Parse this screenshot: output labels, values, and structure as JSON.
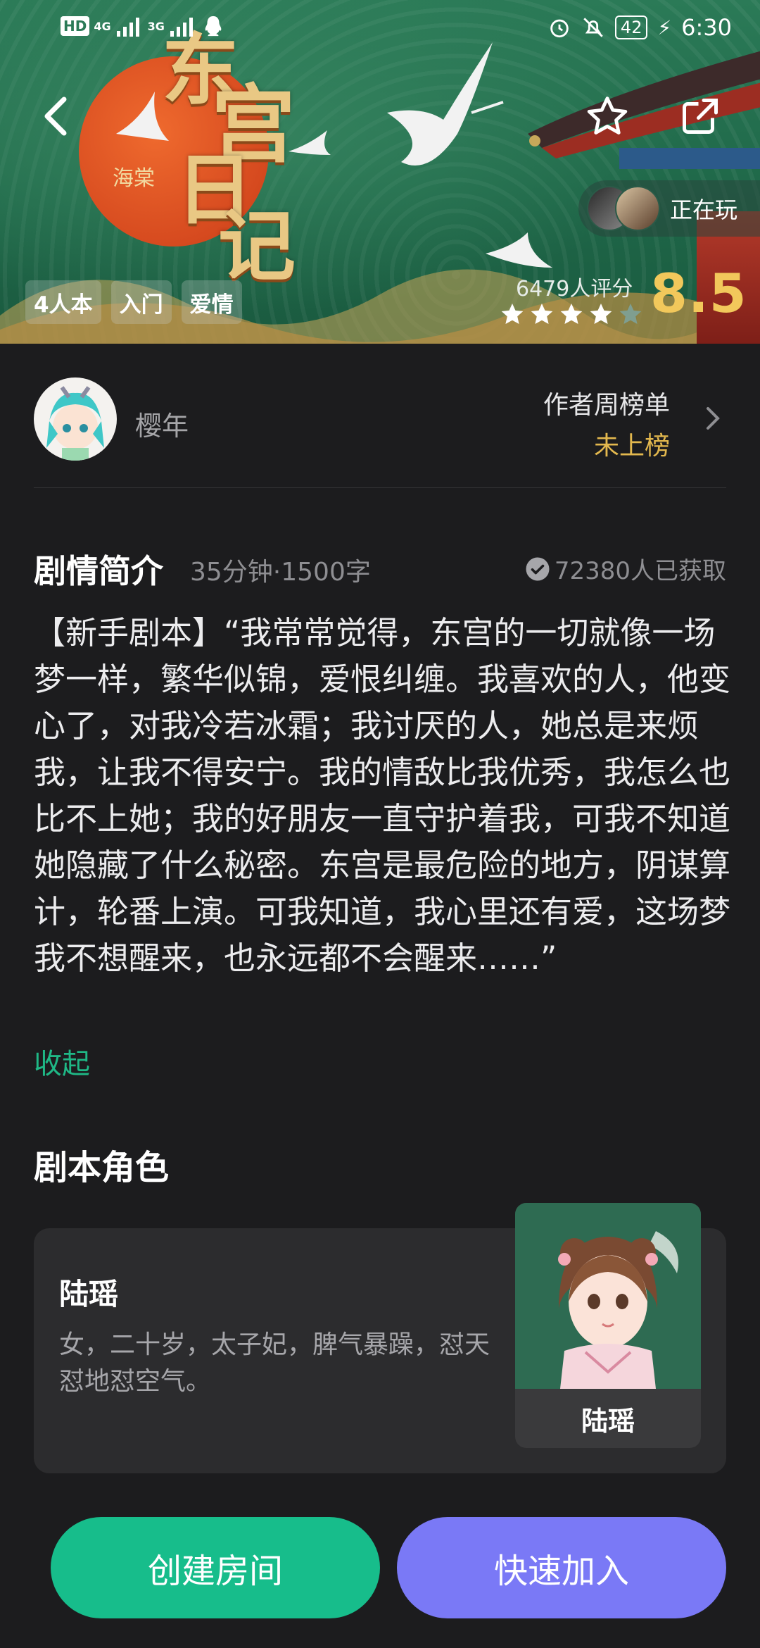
{
  "status_bar": {
    "network_left": "HD",
    "signal_1": "4G",
    "signal_2": "3G",
    "battery": "42",
    "time": "6:30"
  },
  "hero": {
    "title_chars": [
      "东",
      "宫",
      "日",
      "记"
    ],
    "signature": "海棠",
    "tags": [
      "4人本",
      "入门",
      "爱情"
    ],
    "rating_count": "6479人评分",
    "score": "8.5",
    "stars_filled": 4,
    "stars_total": 5,
    "playing_label": "正在玩"
  },
  "author": {
    "name": "樱年",
    "rank_label": "作者周榜单",
    "rank_value": "未上榜"
  },
  "synopsis": {
    "title": "剧情简介",
    "meta": "35分钟·1500字",
    "acquired": "72380人已获取",
    "text": "【新手剧本】“我常常觉得，东宫的一切就像一场梦一样，繁华似锦，爱恨纠缠。我喜欢的人，他变心了，对我冷若冰霜；我讨厌的人，她总是来烦我，让我不得安宁。我的情敌比我优秀，我怎么也比不上她；我的好朋友一直守护着我，可我不知道她隐藏了什么秘密。东宫是最危险的地方，阴谋算计，轮番上演。可我知道，我心里还有爱，这场梦我不想醒来，也永远都不会醒来……”",
    "collapse": "收起"
  },
  "roles": {
    "title": "剧本角色",
    "items": [
      {
        "name": "陆瑶",
        "description": "女，二十岁，太子妃，脾气暴躁，怼天怼地怼空气。",
        "portrait_name": "陆瑶"
      }
    ]
  },
  "actions": {
    "create": "创建房间",
    "join": "快速加入"
  },
  "colors": {
    "accent_green": "#17bd8b",
    "accent_purple": "#7a79f6",
    "score_gold": "#f2c85b",
    "rank_gold": "#e3b84e"
  }
}
